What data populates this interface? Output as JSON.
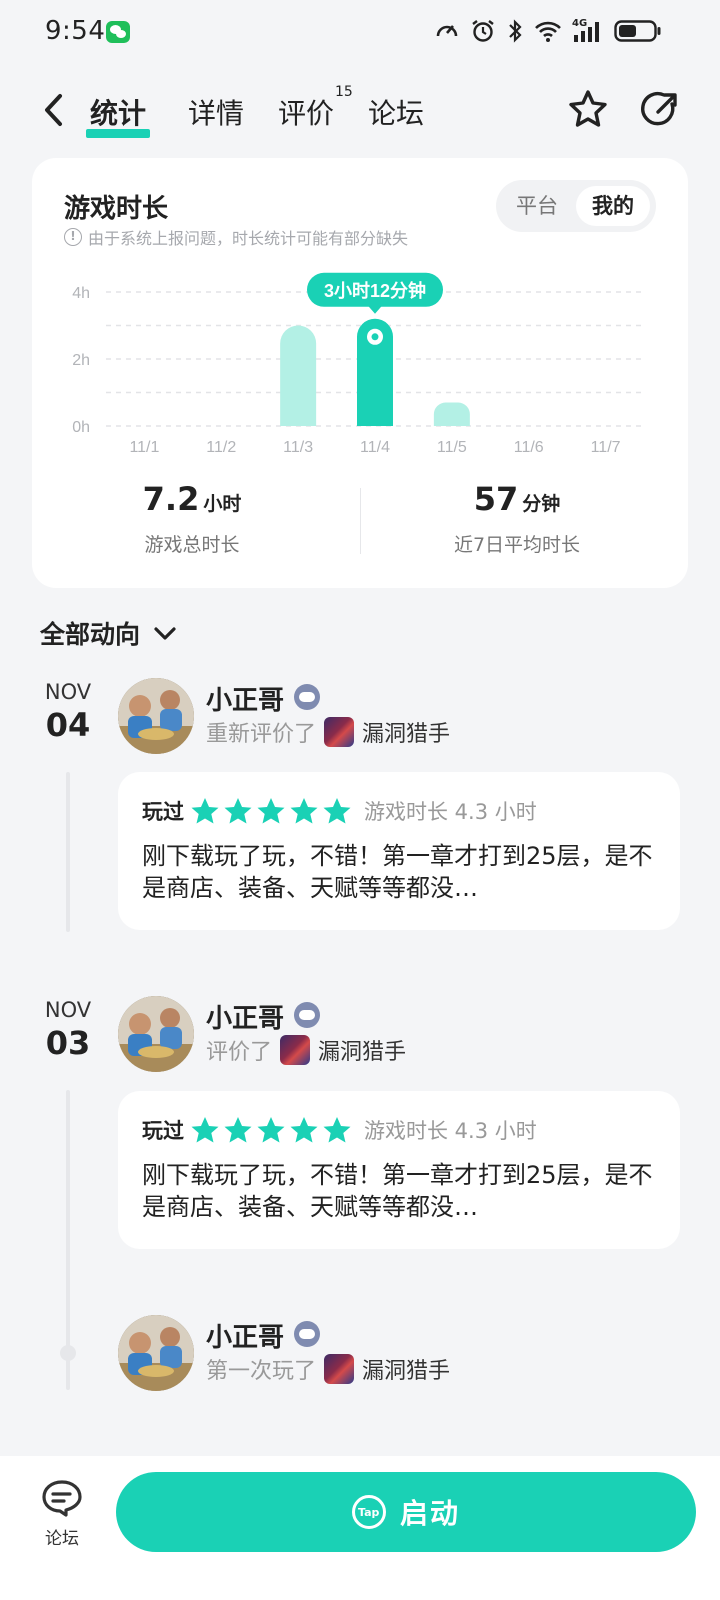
{
  "status_bar": {
    "time": "9:54",
    "network": "4G"
  },
  "nav": {
    "tabs": [
      {
        "label": "统计",
        "active": true
      },
      {
        "label": "详情"
      },
      {
        "label": "评价",
        "badge": "15"
      },
      {
        "label": "论坛"
      }
    ]
  },
  "stats": {
    "title": "游戏时长",
    "note": "由于系统上报问题，时长统计可能有部分缺失",
    "toggle": {
      "platform": "平台",
      "mine": "我的",
      "selected": "我的"
    },
    "total": {
      "value": "7.2",
      "unit": "小时",
      "label": "游戏总时长"
    },
    "average": {
      "value": "57",
      "unit": "分钟",
      "label": "近7日平均时长"
    },
    "tooltip": "3小时12分钟"
  },
  "chart_data": {
    "type": "bar",
    "categories": [
      "11/1",
      "11/2",
      "11/3",
      "11/4",
      "11/5",
      "11/6",
      "11/7"
    ],
    "values": [
      0,
      0,
      3.0,
      3.2,
      0.7,
      0,
      0
    ],
    "ylim": [
      0,
      4
    ],
    "yticks": [
      "0h",
      "2h",
      "4h"
    ],
    "highlight_index": 3,
    "colors": {
      "bar": "#b3f0e5",
      "highlight": "#1ad1b5"
    }
  },
  "activity": {
    "filter_label": "全部动向",
    "entries": [
      {
        "month": "NOV",
        "day": "04",
        "user": "小正哥",
        "action": "重新评价了",
        "game": "漏洞猎手",
        "review": {
          "played": "玩过",
          "rating": 5,
          "playtime": "游戏时长 4.3 小时",
          "text": "刚下载玩了玩，不错！第一章才打到25层，是不是商店、装备、天赋等等都没…"
        }
      },
      {
        "month": "NOV",
        "day": "03",
        "user": "小正哥",
        "action": "评价了",
        "game": "漏洞猎手",
        "review": {
          "played": "玩过",
          "rating": 5,
          "playtime": "游戏时长 4.3 小时",
          "text": "刚下载玩了玩，不错！第一章才打到25层，是不是商店、装备、天赋等等都没…"
        }
      },
      {
        "user": "小正哥",
        "action": "第一次玩了",
        "game": "漏洞猎手"
      }
    ]
  },
  "bottom_bar": {
    "forum_label": "论坛",
    "launch_label": "启动",
    "launch_icon_text": "Tap"
  },
  "colors": {
    "accent": "#1ad1b5",
    "accent_light": "#b3f0e5",
    "background": "#f4f5f7"
  }
}
